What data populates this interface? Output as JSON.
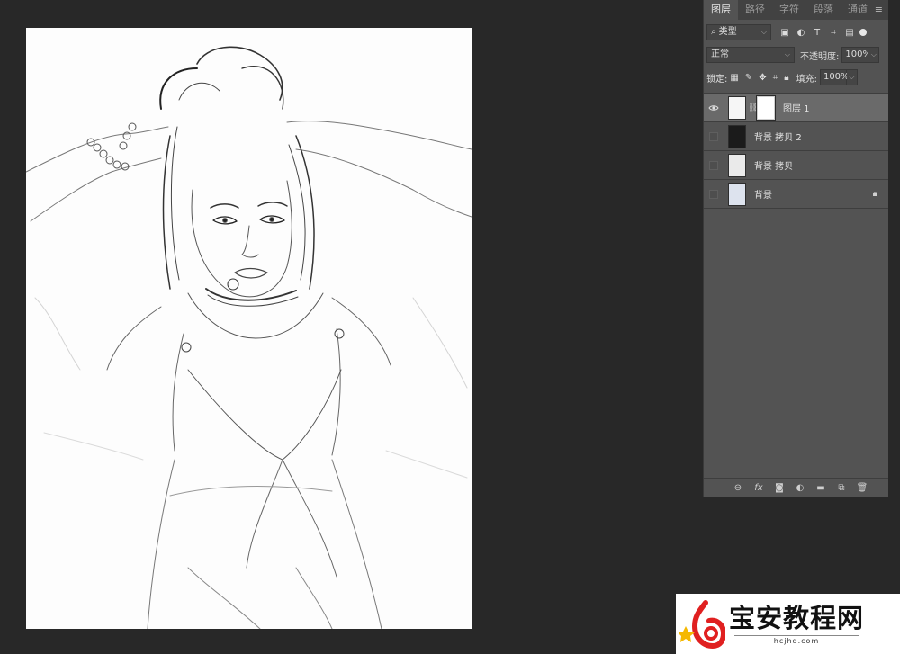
{
  "panel": {
    "tabs": [
      {
        "label": "图层"
      },
      {
        "label": "路径"
      },
      {
        "label": "字符"
      },
      {
        "label": "段落"
      },
      {
        "label": "通道"
      }
    ],
    "menu_icon": "panel-menu-icon",
    "filter": {
      "label": "类型",
      "icon": "search-icon"
    },
    "blend_mode": "正常",
    "opacity_label": "不透明度:",
    "opacity_value": "100%",
    "lock_label": "锁定:",
    "fill_label": "填充:",
    "fill_value": "100%",
    "layers": [
      {
        "name": "图层 1",
        "visible": true,
        "selected": true,
        "has_mask": true
      },
      {
        "name": "背景 拷贝 2",
        "visible": false,
        "selected": false
      },
      {
        "name": "背景 拷贝",
        "visible": false,
        "selected": false
      },
      {
        "name": "背景",
        "visible": false,
        "selected": false,
        "locked": true
      }
    ],
    "footer_icons": [
      "link-icon",
      "fx-icon",
      "mask-icon",
      "adjustment-icon",
      "folder-icon",
      "new-layer-icon",
      "trash-icon"
    ]
  },
  "watermark": {
    "title": "宝安教程网",
    "url": "hcjhd.com"
  },
  "colors": {
    "workspace": "#282828",
    "panel": "#535353",
    "panel_tabs": "#424242",
    "selected_layer": "#6a6a6a",
    "logo_red": "#e02020"
  }
}
